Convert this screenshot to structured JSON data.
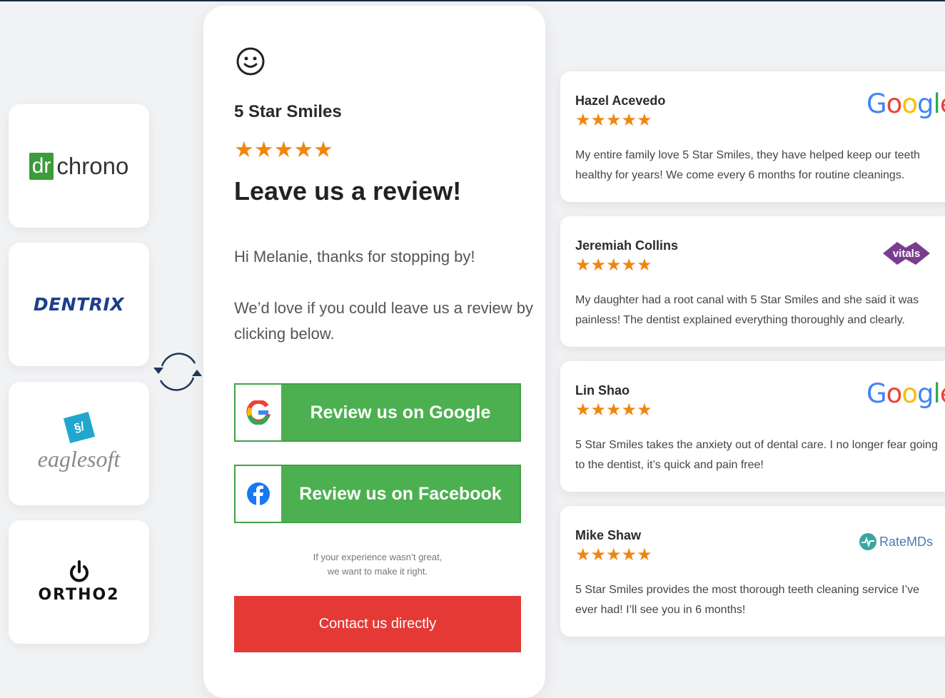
{
  "integrations": {
    "drchrono": {
      "dr": "dr",
      "chrono": "chrono"
    },
    "dentrix": "DENTRIX",
    "eaglesoft": {
      "badge": "§/",
      "name": "eaglesoft"
    },
    "ortho2": "ORTHO2"
  },
  "review_request": {
    "business_name": "5 Star Smiles",
    "rating_stars": "★★★★★",
    "headline": "Leave us a review!",
    "greeting": "Hi Melanie, thanks for stopping by!",
    "message": "We’d love if you could leave us a review by clicking below.",
    "google_button": "Review us on Google",
    "facebook_button": "Review us on Facebook",
    "note_line1": "If your experience wasn’t great,",
    "note_line2": "we want to make it right.",
    "contact_button": "Contact us directly"
  },
  "reviews": [
    {
      "name": "Hazel Acevedo",
      "stars": "★★★★★",
      "source": "Google",
      "text": "My entire family love 5 Star Smiles, they have helped keep our teeth healthy for years! We come every 6 months for routine cleanings."
    },
    {
      "name": "Jeremiah Collins",
      "stars": "★★★★★",
      "source": "vitals",
      "text": "My daughter had a root canal with 5 Star Smiles and she said it was painless! The dentist explained everything thoroughly and clearly."
    },
    {
      "name": "Lin Shao",
      "stars": "★★★★★",
      "source": "Google",
      "text": "5 Star Smiles takes the anxiety out of dental care. I no longer fear going to the dentist, it’s quick and pain free!"
    },
    {
      "name": "Mike Shaw",
      "stars": "★★★★★",
      "source": "RateMDs",
      "text": "5 Star Smiles provides the most thorough teeth cleaning service I’ve ever had! I’ll see you in 6 months!"
    }
  ],
  "colors": {
    "star": "#f0860f",
    "review_button": "#4cb050",
    "contact_button": "#e53935"
  },
  "icons": [
    "smiley-icon",
    "sync-arrows-icon",
    "google-g-icon",
    "facebook-icon",
    "power-icon"
  ]
}
